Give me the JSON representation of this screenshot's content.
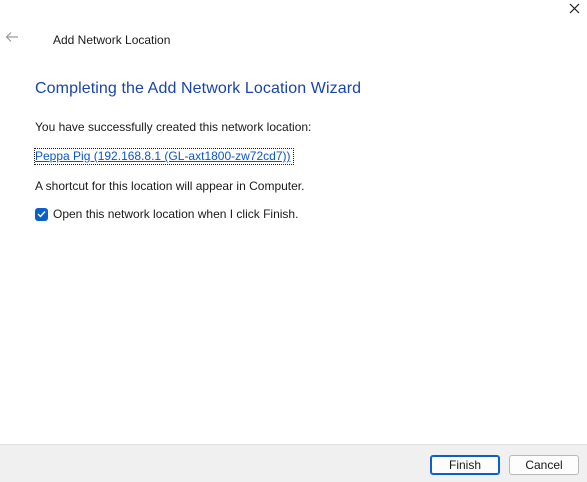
{
  "window": {
    "title": "Add Network Location",
    "close_icon": "close-icon",
    "back_icon": "back-arrow-icon"
  },
  "wizard": {
    "heading": "Completing the Add Network Location Wizard",
    "success_text": "You have successfully created this network location:",
    "location_link": "Peppa Pig (192.168.8.1 (GL-axt1800-zw72cd7))",
    "shortcut_text": "A shortcut for this location will appear in Computer.",
    "open_checkbox": {
      "label": "Open this network location when I click Finish.",
      "checked": true
    }
  },
  "footer": {
    "finish_label": "Finish",
    "cancel_label": "Cancel"
  },
  "colors": {
    "heading": "#1a44a8",
    "link": "#0a56c2",
    "accent": "#0a5fc8",
    "footer_bg": "#f0f0f0"
  }
}
